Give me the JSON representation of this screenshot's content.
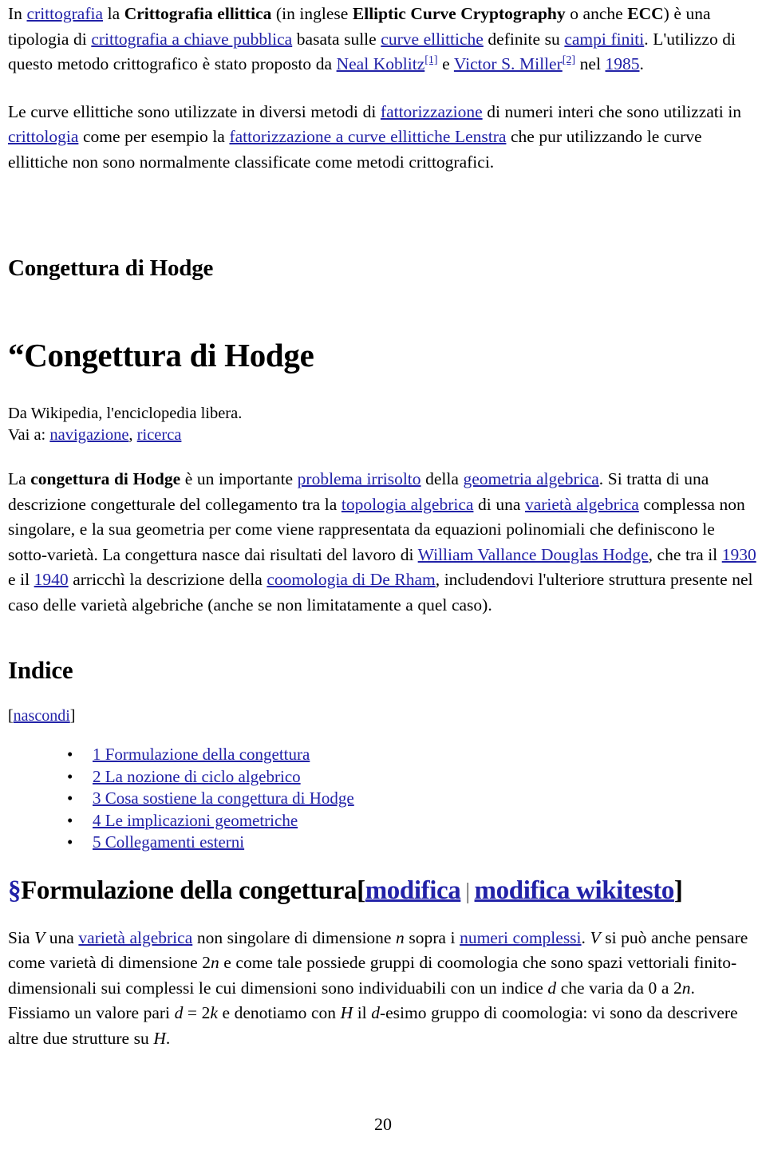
{
  "document": {
    "page_number": "20",
    "link_color": "#2222a8",
    "text_color": "#000000",
    "background_color": "#ffffff"
  },
  "intro": {
    "p1": {
      "t1": "In ",
      "l1": "crittografia",
      "t2": " la ",
      "b1": "Crittografia ellittica",
      "t3": " (in inglese ",
      "b2": "Elliptic Curve Cryptography",
      "t4": " o anche ",
      "b3": "ECC",
      "t5": ") è una tipologia di ",
      "l2": "crittografia a chiave pubblica",
      "t6": " basata sulle ",
      "l3": "curve ellittiche",
      "t7": " definite su ",
      "l4": "campi finiti",
      "t8": ". L'utilizzo di questo metodo crittografico è stato proposto da ",
      "l5": "Neal Koblitz",
      "ref1": "[1]",
      "t9": " e ",
      "l6": "Victor S. Miller",
      "ref2": "[2]",
      "t10": " nel ",
      "l7": "1985",
      "t11": "."
    },
    "p2": {
      "t1": "Le curve ellittiche sono utilizzate in diversi metodi di ",
      "l1": "fattorizzazione",
      "t2": " di numeri interi che sono utilizzati in ",
      "l2": "crittologia",
      "t3": " come per esempio la ",
      "l3": "fattorizzazione a curve ellittiche Lenstra",
      "t4": " che pur utilizzando le curve ellittiche non sono normalmente classificate come metodi crittografici."
    }
  },
  "hodge": {
    "heading_small": "Congettura di Hodge",
    "heading_large": "“Congettura di Hodge",
    "from_wikipedia": "Da Wikipedia, l'enciclopedia libera.",
    "goto_label": "Vai a: ",
    "goto_nav": "navigazione",
    "goto_sep": ", ",
    "goto_search": "ricerca",
    "body": {
      "t1": "La ",
      "b1": "congettura di Hodge",
      "t2": " è un importante ",
      "l1": "problema irrisolto",
      "t3": " della ",
      "l2": "geometria algebrica",
      "t4": ". Si tratta di una descrizione congetturale del collegamento tra la ",
      "l3": "topologia algebrica",
      "t5": " di una ",
      "l4": "varietà algebrica",
      "t6": " complessa non singolare, e la sua geometria per come viene rappresentata da equazioni polinomiali che definiscono le sotto-varietà. La congettura nasce dai risultati del lavoro di ",
      "l5": "William Vallance Douglas Hodge",
      "t7": ", che tra il ",
      "l6": "1930",
      "t8": " e il ",
      "l7": "1940",
      "t9": " arricchì la descrizione della ",
      "l8": "coomologia di De Rham",
      "t10": ", includendovi l'ulteriore struttura presente nel caso delle varietà algebriche (anche se non limitatamente a quel caso)."
    }
  },
  "toc": {
    "heading": "Indice",
    "hide_open_bracket": "[",
    "hide_label": "nascondi",
    "hide_close_bracket": "]",
    "bullet": "•",
    "items": [
      {
        "label": "1 Formulazione della congettura"
      },
      {
        "label": "2 La nozione di ciclo algebrico"
      },
      {
        "label": "3 Cosa sostiene la congettura di Hodge"
      },
      {
        "label": "4 Le implicazioni geometriche"
      },
      {
        "label": "5 Collegamenti esterni"
      }
    ]
  },
  "section": {
    "anchor_symbol": "§",
    "title": "Formulazione della congettura",
    "open_bracket": "[",
    "edit_label": "modifica",
    "edit_separator": "|",
    "edit_source_label": "modifica wikitesto",
    "close_bracket": "]",
    "body": {
      "t1": "Sia ",
      "i1": "V",
      "t2": " una ",
      "l1": "varietà algebrica",
      "t3": " non singolare di dimensione ",
      "i2": "n",
      "t4": " sopra i ",
      "l2": "numeri complessi",
      "t5": ". ",
      "i3": "V",
      "t6": " si può anche pensare come varietà di dimensione 2",
      "i4": "n",
      "t7": " e come tale possiede gruppi di coomologia che sono spazi vettoriali finito-dimensionali sui complessi le cui dimensioni sono individuabili con un indice ",
      "i5": "d",
      "t8": " che varia da 0 a 2",
      "i6": "n",
      "t9": ". Fissiamo un valore pari ",
      "i7": "d",
      "t10": " = 2",
      "i8": "k",
      "t11": " e denotiamo con ",
      "i9": "H",
      "t12": " il ",
      "i10": "d",
      "t13": "-esimo gruppo di coomologia: vi sono da descrivere altre due strutture su ",
      "i11": "H",
      "t14": "."
    }
  }
}
